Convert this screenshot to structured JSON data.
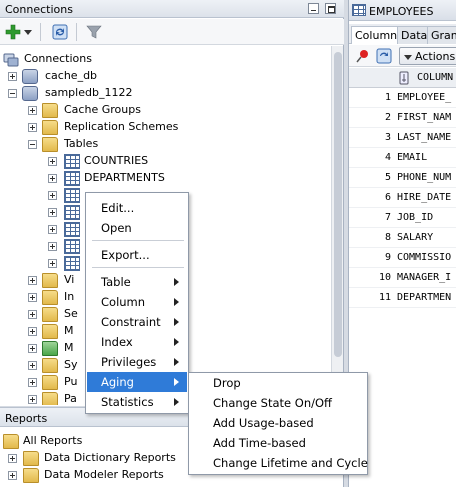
{
  "connections_panel": {
    "title": "Connections",
    "toolbar": {
      "icons": [
        "add-icon",
        "dropdown-arrow-icon",
        "refresh-icon",
        "filter-icon"
      ]
    },
    "tree": [
      {
        "label": "Connections",
        "icon": "connections-icon"
      },
      {
        "label": "cache_db",
        "icon": "database-icon"
      },
      {
        "label": "sampledb_1122",
        "icon": "database-icon"
      },
      {
        "label": "Cache Groups",
        "icon": "folder-icon"
      },
      {
        "label": "Replication Schemes",
        "icon": "folder-icon"
      },
      {
        "label": "Tables",
        "icon": "folder-icon"
      },
      {
        "label": "COUNTRIES",
        "icon": "table-icon"
      },
      {
        "label": "DEPARTMENTS",
        "icon": "table-icon"
      },
      {
        "label": "Vi"
      },
      {
        "label": "In"
      },
      {
        "label": "Se"
      },
      {
        "label": "M"
      },
      {
        "label": "M"
      },
      {
        "label": "Sy"
      },
      {
        "label": "Pu"
      },
      {
        "label": "Pa"
      }
    ]
  },
  "reports_panel": {
    "title": "Reports",
    "items": [
      {
        "label": "All Reports"
      },
      {
        "label": "Data Dictionary Reports"
      },
      {
        "label": "Data Modeler Reports"
      }
    ]
  },
  "editor": {
    "tab_title": "EMPLOYEES",
    "subtabs": [
      "Columns",
      "Data",
      "Grant"
    ],
    "actions_label": "Actions...",
    "column_header": "COLUMN",
    "rows": [
      {
        "num": "1",
        "name": "EMPLOYEE_"
      },
      {
        "num": "2",
        "name": "FIRST_NAM"
      },
      {
        "num": "3",
        "name": "LAST_NAME"
      },
      {
        "num": "4",
        "name": "EMAIL"
      },
      {
        "num": "5",
        "name": "PHONE_NUM"
      },
      {
        "num": "6",
        "name": "HIRE_DATE"
      },
      {
        "num": "7",
        "name": "JOB_ID"
      },
      {
        "num": "8",
        "name": "SALARY"
      },
      {
        "num": "9",
        "name": "COMMISSIO"
      },
      {
        "num": "10",
        "name": "MANAGER_I"
      },
      {
        "num": "11",
        "name": "DEPARTMEN"
      }
    ]
  },
  "context_menu": {
    "items": [
      {
        "label": "Edit...",
        "has_submenu": false
      },
      {
        "label": "Open",
        "has_submenu": false
      },
      {
        "label": "Export...",
        "has_submenu": false
      },
      {
        "label": "Table",
        "has_submenu": true
      },
      {
        "label": "Column",
        "has_submenu": true
      },
      {
        "label": "Constraint",
        "has_submenu": true
      },
      {
        "label": "Index",
        "has_submenu": true
      },
      {
        "label": "Privileges",
        "has_submenu": true
      },
      {
        "label": "Aging",
        "has_submenu": true,
        "highlighted": true
      },
      {
        "label": "Statistics",
        "has_submenu": true
      }
    ],
    "highlight_color": "#2f7bd8"
  },
  "aging_submenu": {
    "items": [
      {
        "label": "Drop"
      },
      {
        "label": "Change State On/Off"
      },
      {
        "label": "Add Usage-based"
      },
      {
        "label": "Add Time-based"
      },
      {
        "label": "Change Lifetime and Cycle"
      }
    ]
  }
}
